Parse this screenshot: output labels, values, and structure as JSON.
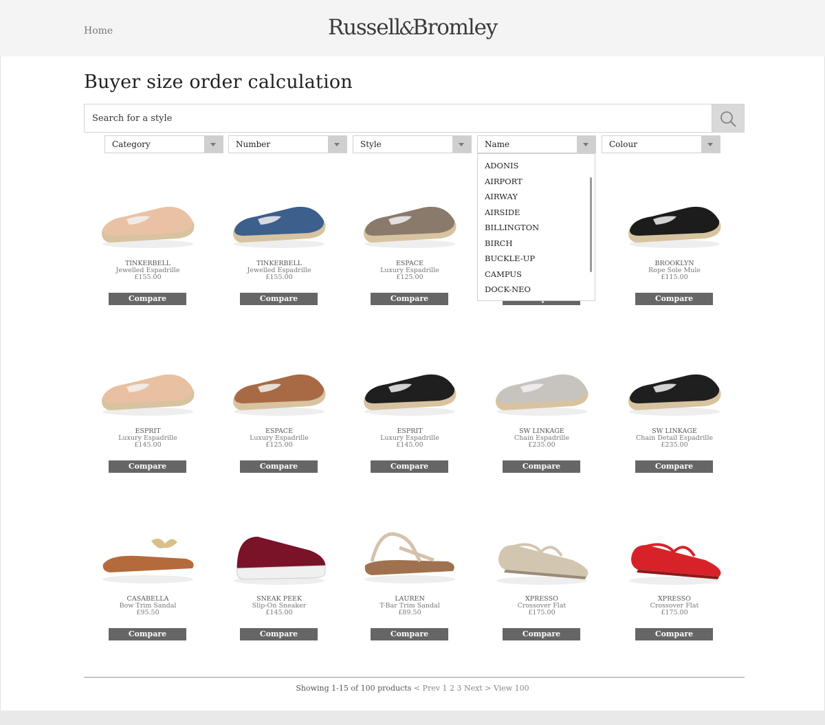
{
  "header": {
    "home_label": "Home",
    "logo_left": "Russell",
    "logo_amp": "&",
    "logo_right": "Bromley"
  },
  "page_title": "Buyer size order calculation",
  "search": {
    "placeholder": "Search for a style",
    "icon": "search-icon"
  },
  "filters": [
    {
      "label": "Category"
    },
    {
      "label": "Number"
    },
    {
      "label": "Style"
    },
    {
      "label": "Name"
    },
    {
      "label": "Colour"
    }
  ],
  "name_dropdown": {
    "open": true,
    "options": [
      "ADONIS",
      "AIRPORT",
      "AIRWAY",
      "AIRSIDE",
      "BILLINGTON",
      "BIRCH",
      "BUCKLE-UP",
      "CAMPUS",
      "DOCK-NEO"
    ]
  },
  "compare_label": "Compare",
  "products": [
    {
      "name": "TINKERBELL",
      "desc": "Jewelled Espadrille",
      "price": "£155.00",
      "color": "#e9c2a6",
      "sole": "#d8c3a0",
      "visible_text": true
    },
    {
      "name": "TINKERBELL",
      "desc": "Jewelled Espadrille",
      "price": "£155.00",
      "color": "#3c5f8c",
      "sole": "#d8c3a0",
      "visible_text": true
    },
    {
      "name": "ESPACE",
      "desc": "Luxury Espadrille",
      "price": "£125.00",
      "color": "#8a7a6c",
      "sole": "#d8c3a0",
      "visible_text": true
    },
    {
      "name": "",
      "desc": "",
      "price": "",
      "color": "#cccccc",
      "sole": "#d8c3a0",
      "visible_text": false
    },
    {
      "name": "BROOKLYN",
      "desc": "Rope Sole Mule",
      "price": "£115.00",
      "color": "#1c1c1c",
      "sole": "#d8c3a0",
      "visible_text": true
    },
    {
      "name": "ESPRIT",
      "desc": "Luxury Espadrille",
      "price": "£145.00",
      "color": "#e8c0a2",
      "sole": "#d8c3a0",
      "visible_text": true
    },
    {
      "name": "ESPACE",
      "desc": "Luxury Espadrille",
      "price": "£125.00",
      "color": "#a86a45",
      "sole": "#d8c3a0",
      "visible_text": true
    },
    {
      "name": "ESPRIT",
      "desc": "Luxury Espadrille",
      "price": "£145.00",
      "color": "#1f1f1f",
      "sole": "#d8c3a0",
      "visible_text": true
    },
    {
      "name": "SW LINKAGE",
      "desc": "Chain Espadrille",
      "price": "£235.00",
      "color": "#c7c4bf",
      "sole": "#d8c3a0",
      "visible_text": true
    },
    {
      "name": "SW LINKAGE",
      "desc": "Chain Detail Espadrille",
      "price": "£235.00",
      "color": "#1f1f1f",
      "sole": "#d8c3a0",
      "visible_text": true
    },
    {
      "name": "CASABELLA",
      "desc": "Bow Trim Sandal",
      "price": "£95.50",
      "color": "#b56a3c",
      "sole": "#c98c5c",
      "visible_text": true
    },
    {
      "name": "SNEAK PEEK",
      "desc": "Slip-On Sneaker",
      "price": "£145.00",
      "color": "#7a1228",
      "sole": "#f0f0f0",
      "visible_text": true
    },
    {
      "name": "LAUREN",
      "desc": "T-Bar Trim Sandal",
      "price": "£89.50",
      "color": "#d5c1ac",
      "sole": "#a0714f",
      "visible_text": true
    },
    {
      "name": "XPRESSO",
      "desc": "Crossover Flat",
      "price": "£175.00",
      "color": "#d3c6b0",
      "sole": "#9a8a78",
      "visible_text": true
    },
    {
      "name": "XPRESSO",
      "desc": "Crossover Flat",
      "price": "£175.00",
      "color": "#d8222a",
      "sole": "#8a1a1a",
      "visible_text": true
    }
  ],
  "pagination": {
    "showing": "Showing 1-15 of 100 products",
    "prev": "< Prev",
    "pages": [
      "1",
      "2",
      "3"
    ],
    "next": "Next >",
    "view": "View 100"
  }
}
